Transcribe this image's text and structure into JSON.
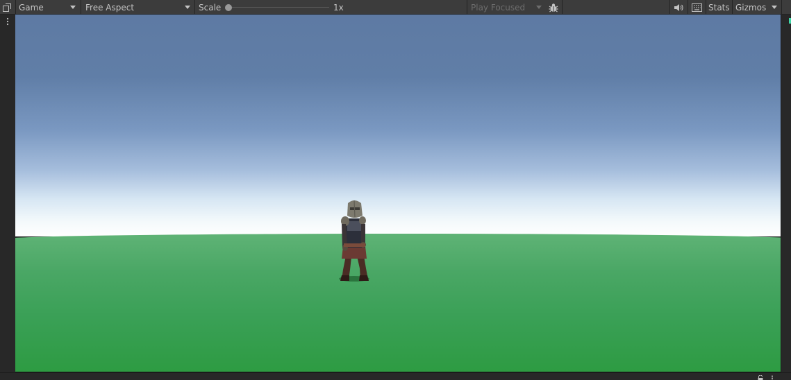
{
  "toolbar": {
    "view_dropdown": "Game",
    "aspect_dropdown": "Free Aspect",
    "scale_label": "Scale",
    "scale_value": "1x",
    "scale_slider_fraction": 0.0,
    "play_focused_dropdown": "Play Focused",
    "stats_label": "Stats",
    "gizmos_label": "Gizmos"
  },
  "icons": {
    "panel_menu": "maximize-panel-icon",
    "left_more": "vertical-ellipsis-icon",
    "bug": "bug-icon",
    "audio": "speaker-icon",
    "keyboard": "keyboard-icon",
    "lock": "lock-icon",
    "more": "vertical-ellipsis-icon"
  },
  "scene": {
    "sky_top_color": "#5e7aa3",
    "horizon_color": "#ffffff",
    "ground_color": "#3aa056"
  }
}
